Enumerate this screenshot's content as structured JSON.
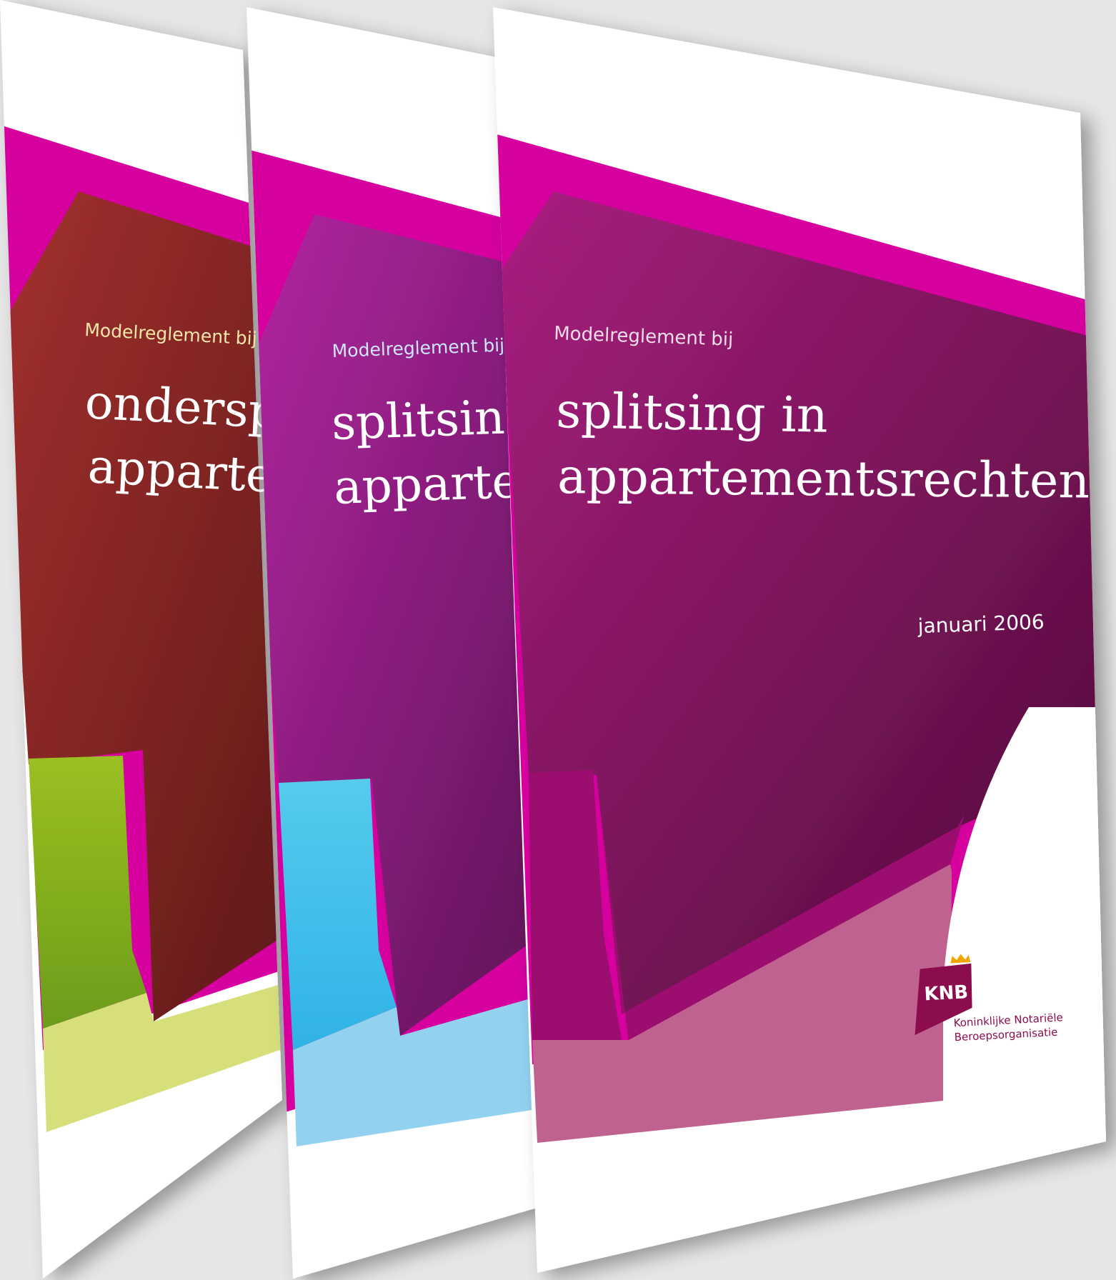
{
  "covers": [
    {
      "id": "back",
      "subtitle": "Modelreglement bij",
      "title_line1": "ondersp",
      "title_line2": "apparte",
      "colors": {
        "band": "#d6059f",
        "main": "#a3302f",
        "main_dark": "#5e1a18",
        "accent": "#96bf21",
        "accent_light": "#d6df7a",
        "subtitle": "#f4e7a9"
      }
    },
    {
      "id": "middle",
      "subtitle": "Modelreglement bij",
      "title_line1": "splitsin",
      "title_line2": "apparte",
      "colors": {
        "band": "#d6059f",
        "main": "#b226a1",
        "main_dark": "#5e1457",
        "accent": "#44c2ea",
        "accent_light": "#93d2ef",
        "subtitle": "#cfe6ff"
      }
    },
    {
      "id": "front",
      "subtitle": "Modelreglement bij",
      "title_line1": "splitsing in",
      "title_line2": "appartementsrechten",
      "date": "januari 2006",
      "colors": {
        "band": "#d6059f",
        "main": "#a81f7f",
        "main_dark": "#4f0b38",
        "accent": "#9b0d6e",
        "accent_light": "#c0628f",
        "subtitle": "#f1dce8"
      }
    }
  ],
  "logo": {
    "mark": "KNB",
    "line1": "Koninklijke Notariële",
    "line2": "Beroepsorganisatie",
    "icon": "crown-icon",
    "color": "#8c0d4e",
    "crown_color": "#f0a600"
  }
}
